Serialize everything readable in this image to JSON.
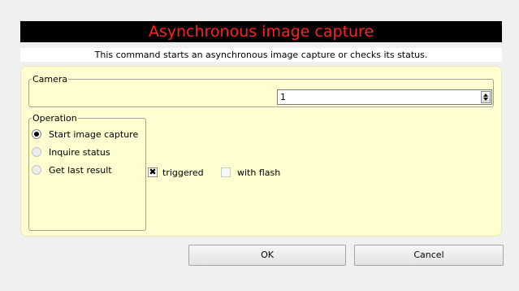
{
  "header": {
    "title": "Asynchronous image capture",
    "subtitle": "This command starts an asynchronous image capture or checks its status."
  },
  "camera": {
    "label": "Camera",
    "value": "1"
  },
  "operation": {
    "label": "Operation",
    "options": [
      {
        "label": "Start image capture",
        "selected": true
      },
      {
        "label": "Inquire status",
        "selected": false
      },
      {
        "label": "Get last result",
        "selected": false
      }
    ]
  },
  "options": {
    "triggered": {
      "label": "triggered",
      "checked": true,
      "mark": "✖"
    },
    "with_flash": {
      "label": "with flash",
      "checked": false
    }
  },
  "buttons": {
    "ok": "OK",
    "cancel": "Cancel"
  },
  "colors": {
    "title_text": "#ff2020",
    "title_bg": "#000000",
    "panel_bg": "#fffed0"
  }
}
